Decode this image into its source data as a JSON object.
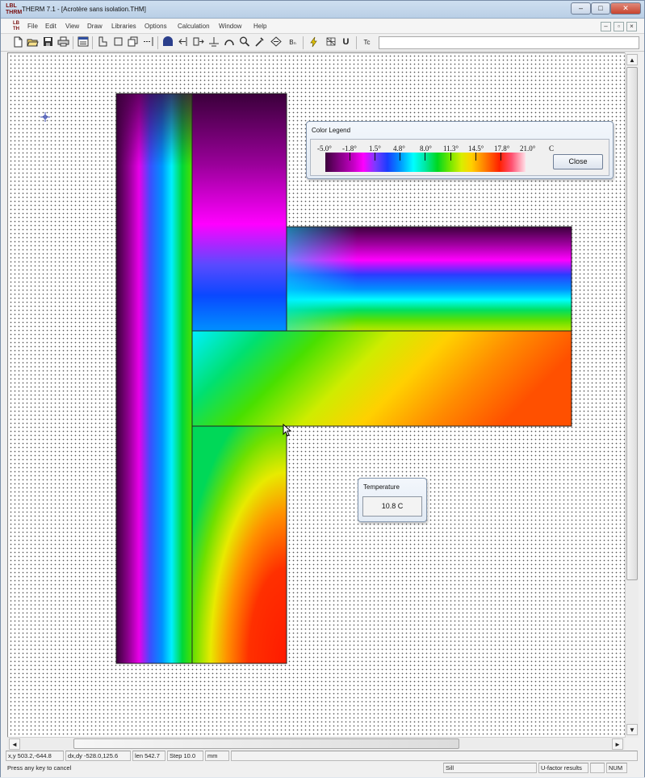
{
  "app": {
    "title": "THERM 7.1 - [Acrotère sans isolation.THM]",
    "icon_label": "LBL THERM"
  },
  "window_controls": {
    "minimize": "–",
    "maximize": "□",
    "close": "✕"
  },
  "menu": {
    "items": [
      "File",
      "Edit",
      "View",
      "Draw",
      "Libraries",
      "Options",
      "Calculation",
      "Window",
      "Help"
    ],
    "mdi_controls": {
      "minimize": "–",
      "restore": "▫",
      "close": "×"
    }
  },
  "toolbar": {
    "icons": [
      "new-file-icon",
      "open-folder-icon",
      "save-icon",
      "print-icon",
      "properties-icon",
      "polygon-icon",
      "rectangle-icon",
      "fill-void-icon",
      "locate-icon",
      "boundary-condition-icon",
      "insert-point-icon",
      "move-point-icon",
      "snap-icon",
      "arc-icon",
      "zoom-icon",
      "eyedropper-icon",
      "rotate-icon",
      "boundary-label-icon",
      "calculate-icon",
      "mesh-icon",
      "u-factor-icon",
      "fraction-icon"
    ],
    "bc_label": "Bₙ",
    "u_label": "U",
    "fraction_label": "Tc"
  },
  "colors": {
    "canvas": "#ffffff",
    "grid_dot": "#555555",
    "outline": "#222222"
  },
  "color_legend": {
    "title": "Color Legend",
    "labels": [
      "-5.0°",
      "-1.8°",
      "1.5°",
      "4.8°",
      "8.0°",
      "11.3°",
      "14.5°",
      "17.8°",
      "21.0°"
    ],
    "unit": "C",
    "close_label": "Close"
  },
  "temperature_popup": {
    "title": "Temperature",
    "value": "10.8 C"
  },
  "statusbar": {
    "xy": "x,y  503.2,-644.8",
    "dxdy": "dx,dy  -528.0,125.6",
    "len": "len  542.7",
    "step": "Step  10.0",
    "unit": "mm",
    "message": "Press any key to cancel",
    "mode": "Sill",
    "results": "U-factor results",
    "num": "NUM"
  },
  "scroll": {
    "left": "◄",
    "right": "►",
    "up": "▲",
    "down": "▼"
  }
}
